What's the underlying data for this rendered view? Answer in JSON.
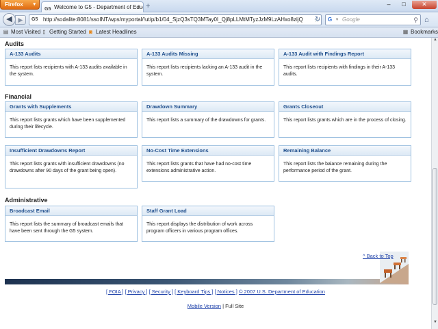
{
  "browser": {
    "app_button": "Firefox",
    "tab_favicon": "G5",
    "tab_title": "Welcome to G5 - Department of Educati...",
    "url": "http://sodalite:8081/ssoINT/wps/myportal/!ut/p/b1/04_SjzQ3sTQ3MTay0I_Qj8pLLMtMTyzJzM9LzAHxo8zijQz8DQ",
    "search_placeholder": "Google",
    "bookmarks": [
      "Most Visited",
      "Getting Started",
      "Latest Headlines"
    ],
    "bookmarks_menu": "Bookmarks"
  },
  "sections": {
    "audits": {
      "title": "Audits",
      "cards": [
        {
          "title": "A-133 Audits",
          "desc": "This report lists recipients with A-133 audits available in the system."
        },
        {
          "title": "A-133 Audits Missing",
          "desc": "This report lists recipients lacking an A-133 audit in the system."
        },
        {
          "title": "A-133 Audit with Findings Report",
          "desc": "This report lists recipients with findings in their A-133 audits."
        }
      ]
    },
    "financial": {
      "title": "Financial",
      "cards": [
        {
          "title": "Grants with Supplements",
          "desc": "This report lists grants which have been supplemented during their lifecycle."
        },
        {
          "title": "Drawdown Summary",
          "desc": "This report lists a summary of the drawdowns for grants."
        },
        {
          "title": "Grants Closeout",
          "desc": "This report lists grants which are in the process of closing."
        },
        {
          "title": "Insufficient Drawdowns Report",
          "desc": "This report lists grants with insufficient drawdowns (no drawdowns after 90 days of the grant being open)."
        },
        {
          "title": "No-Cost Time Extensions",
          "desc": "This report lists grants that have had no-cost time extensions administrative action."
        },
        {
          "title": "Remaining Balance",
          "desc": "This report lists the balance remaining during the performance period of the grant."
        }
      ]
    },
    "administrative": {
      "title": "Administrative",
      "cards": [
        {
          "title": "Broadcast Email",
          "desc": "This report lists the summary of broadcast emails that have been sent through the G5 system."
        },
        {
          "title": "Staff Grant Load",
          "desc": "This report displays the distribution of work across program officers in various program offices."
        }
      ]
    }
  },
  "back_to_top": "^ Back to Top",
  "footer": {
    "links": [
      "[ FOIA ]",
      "[ Privacy ]",
      "[ Security ]",
      "[ Keyboard Tips ]",
      "[ Notices ]",
      "© 2007 U.S. Department of Education"
    ],
    "mobile": "Mobile Version",
    "separator": " | ",
    "full_site": "Full Site"
  }
}
